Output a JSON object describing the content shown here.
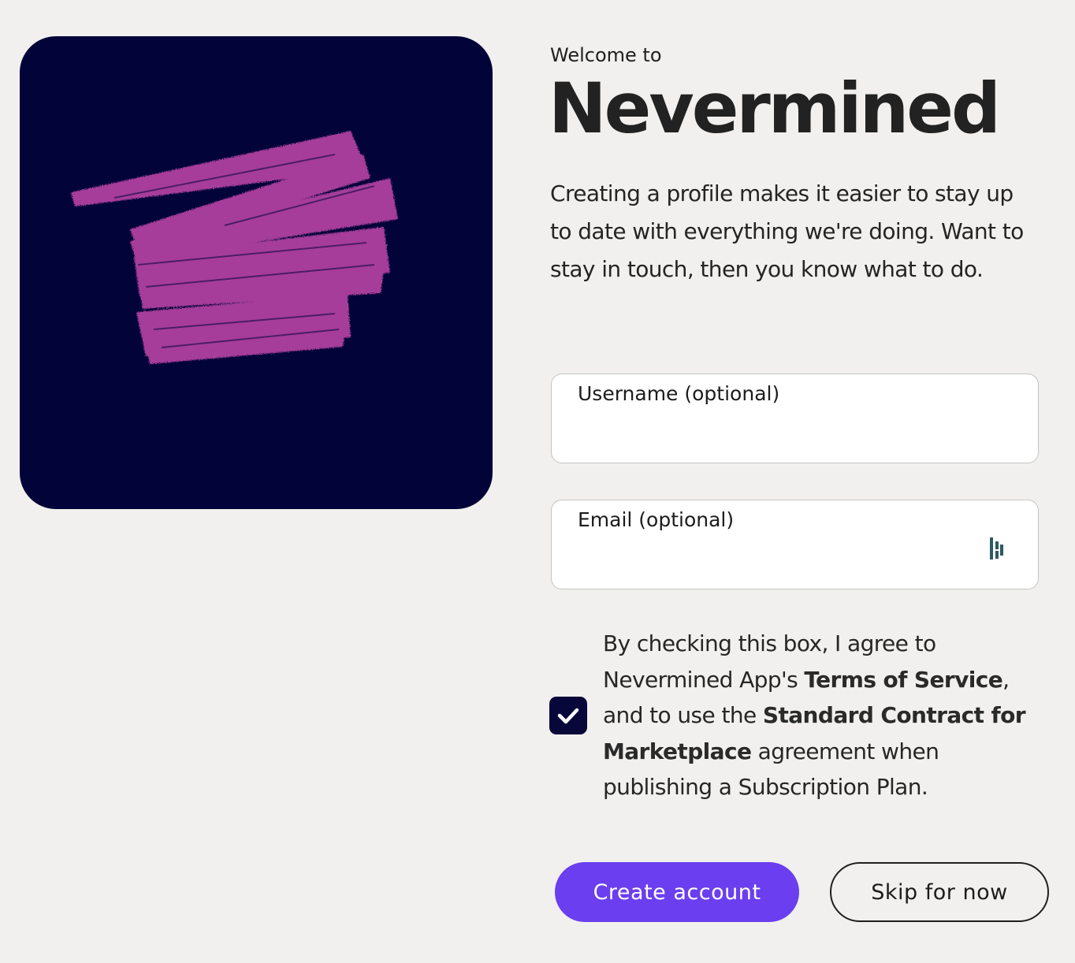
{
  "hero": {
    "background_color": "#020338",
    "scribble_color": "#a63d9a"
  },
  "header": {
    "welcome": "Welcome to",
    "brand": "Nevermined"
  },
  "intro": {
    "text": "Creating a profile makes it easier to stay up to date with everything we're doing. Want to stay in touch, then you know what to do."
  },
  "form": {
    "username": {
      "label": "Username (optional)",
      "value": ""
    },
    "email": {
      "label": "Email (optional)",
      "value": "",
      "autofill_icon": "password-manager-icon"
    },
    "agreement": {
      "checked": true,
      "text_1": "By checking this box, I agree to Nevermined App's ",
      "terms_link": "Terms of Service",
      "text_2": ", and to use the ",
      "contract_link": "Standard Contract for Marketplace",
      "text_3": " agreement when publishing a Subscription Plan."
    }
  },
  "actions": {
    "create_label": "Create account",
    "skip_label": "Skip for now"
  },
  "colors": {
    "accent": "#6b3ef0",
    "checkbox": "#07073a",
    "page_background": "#f1f0ee"
  }
}
